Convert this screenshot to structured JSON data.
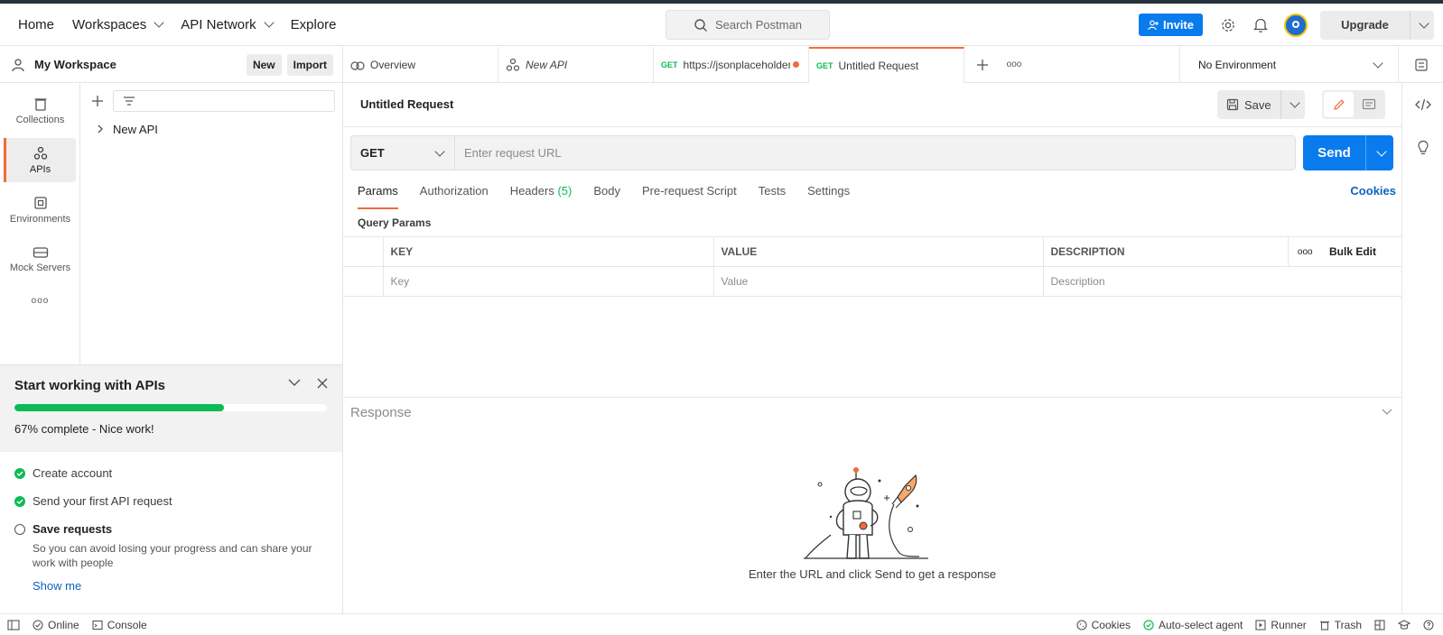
{
  "header": {
    "nav": [
      {
        "label": "Home"
      },
      {
        "label": "Workspaces"
      },
      {
        "label": "API Network"
      },
      {
        "label": "Explore"
      }
    ],
    "search_placeholder": "Search Postman",
    "invite_label": "Invite",
    "upgrade_label": "Upgrade"
  },
  "workspace": {
    "name": "My Workspace",
    "new_label": "New",
    "import_label": "Import"
  },
  "sidebar": {
    "items": [
      {
        "label": "Collections",
        "icon": "trash-can-icon"
      },
      {
        "label": "APIs",
        "icon": "apis-icon",
        "active": true
      },
      {
        "label": "Environments",
        "icon": "environment-icon"
      },
      {
        "label": "Mock Servers",
        "icon": "server-icon"
      }
    ],
    "more_label": "ooo"
  },
  "tree": {
    "items": [
      {
        "label": "New API"
      }
    ]
  },
  "onboarding": {
    "title": "Start working with APIs",
    "progress": 0.67,
    "progress_text": "67% complete - Nice work!",
    "tasks": [
      {
        "label": "Create account",
        "done": true
      },
      {
        "label": "Send your first API request",
        "done": true
      },
      {
        "label": "Save requests",
        "done": false,
        "description": "So you can avoid losing your progress and can share your work with people",
        "link": "Show me"
      }
    ]
  },
  "tabs": [
    {
      "label": "Overview",
      "method": ""
    },
    {
      "label": "New API",
      "method": ""
    },
    {
      "label": "https://jsonplaceholder",
      "method": "GET",
      "unsaved": true
    },
    {
      "label": "Untitled Request",
      "method": "GET",
      "active": true
    }
  ],
  "environment": {
    "label": "No Environment"
  },
  "request": {
    "title": "Untitled Request",
    "save_label": "Save",
    "method": "GET",
    "url_placeholder": "Enter request URL",
    "send_label": "Send",
    "tabs": [
      {
        "label": "Params",
        "active": true
      },
      {
        "label": "Authorization"
      },
      {
        "label": "Headers",
        "count": "(5)"
      },
      {
        "label": "Body"
      },
      {
        "label": "Pre-request Script"
      },
      {
        "label": "Tests"
      },
      {
        "label": "Settings"
      }
    ],
    "cookies_label": "Cookies",
    "query_params_title": "Query Params",
    "table": {
      "headers": [
        "KEY",
        "VALUE",
        "DESCRIPTION"
      ],
      "more_label": "ooo",
      "bulk_edit_label": "Bulk Edit",
      "placeholders": [
        "Key",
        "Value",
        "Description"
      ]
    }
  },
  "response": {
    "title": "Response",
    "message": "Enter the URL and click Send to get a response"
  },
  "statusbar": {
    "left": [
      {
        "label": "Online"
      },
      {
        "label": "Console"
      }
    ],
    "right": [
      {
        "label": "Cookies"
      },
      {
        "label": "Auto-select agent"
      },
      {
        "label": "Runner"
      },
      {
        "label": "Trash"
      }
    ]
  },
  "colors": {
    "accent": "#f26b3a",
    "primary": "#097bed",
    "success": "#0cbb52",
    "link": "#0b64c0"
  }
}
